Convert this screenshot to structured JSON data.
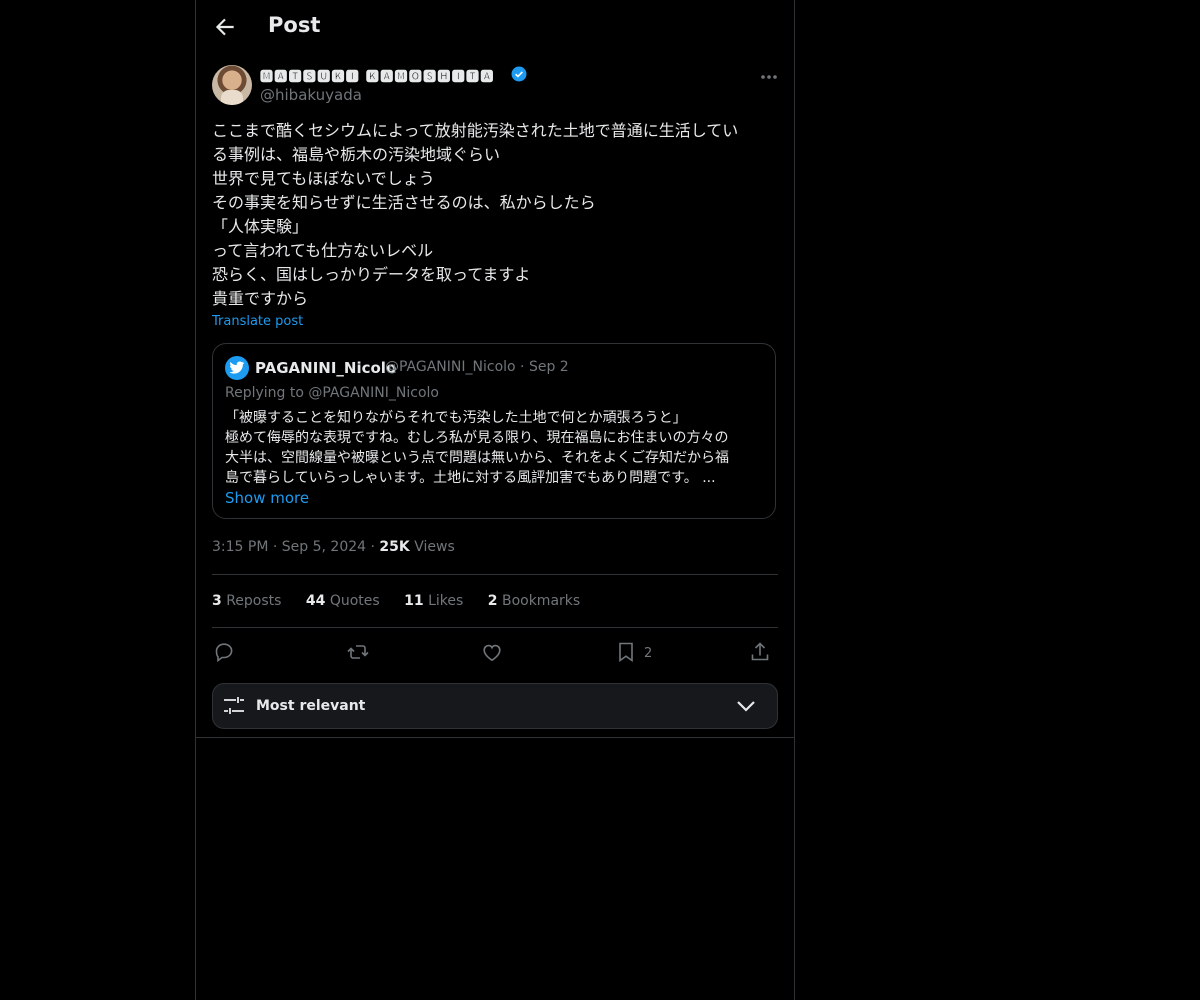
{
  "header": {
    "title": "Post"
  },
  "author": {
    "display_name": "🅼🅰🆃🆂🆄🅺🅸 🅺🅰🅼🅾🆂🅷🅸🆃🅰",
    "handle": "@hibakuyada"
  },
  "post": {
    "lines": [
      "ここまで酷くセシウムによって放射能汚染された土地で普通に生活してい",
      "る事例は、福島や栃木の汚染地域ぐらい",
      "世界で見てもほぼないでしょう",
      "その事実を知らせずに生活させるのは、私からしたら",
      "「人体実験」",
      "って言われても仕方ないレベル",
      "恐らく、国はしっかりデータを取ってますよ",
      "貴重ですから"
    ],
    "translate_label": "Translate post",
    "time": "3:15 PM",
    "date": "Sep 5, 2024",
    "views_count": "25K",
    "views_label": "Views"
  },
  "quote": {
    "name": "PAGANINI_Nicolo",
    "handle": "@PAGANINI_Nicolo",
    "date": "Sep 2",
    "replying_to": "Replying to @PAGANINI_Nicolo",
    "lines": [
      "「被曝することを知りながらそれでも汚染した土地で何とか頑張ろうと」",
      "極めて侮辱的な表現ですね。むしろ私が見る限り、現在福島にお住まいの方々の",
      "大半は、空間線量や被曝という点で問題は無いから、それをよくご存知だから福",
      "島で暮らしていらっしゃいます。土地に対する風評加害でもあり問題です。 ..."
    ],
    "show_more": "Show more"
  },
  "stats": {
    "reposts_count": "3",
    "reposts_label": "Reposts",
    "quotes_count": "44",
    "quotes_label": "Quotes",
    "likes_count": "11",
    "likes_label": "Likes",
    "bookmarks_count": "2",
    "bookmarks_label": "Bookmarks"
  },
  "actions": {
    "bookmark_count": "2",
    "icons": [
      "reply-icon",
      "repost-icon",
      "like-icon",
      "bookmark-icon",
      "share-icon"
    ]
  },
  "sort": {
    "label": "Most relevant"
  },
  "colors": {
    "accent": "#1d9bf0",
    "background": "#000000",
    "muted": "#71767b",
    "border": "#2f3336"
  }
}
